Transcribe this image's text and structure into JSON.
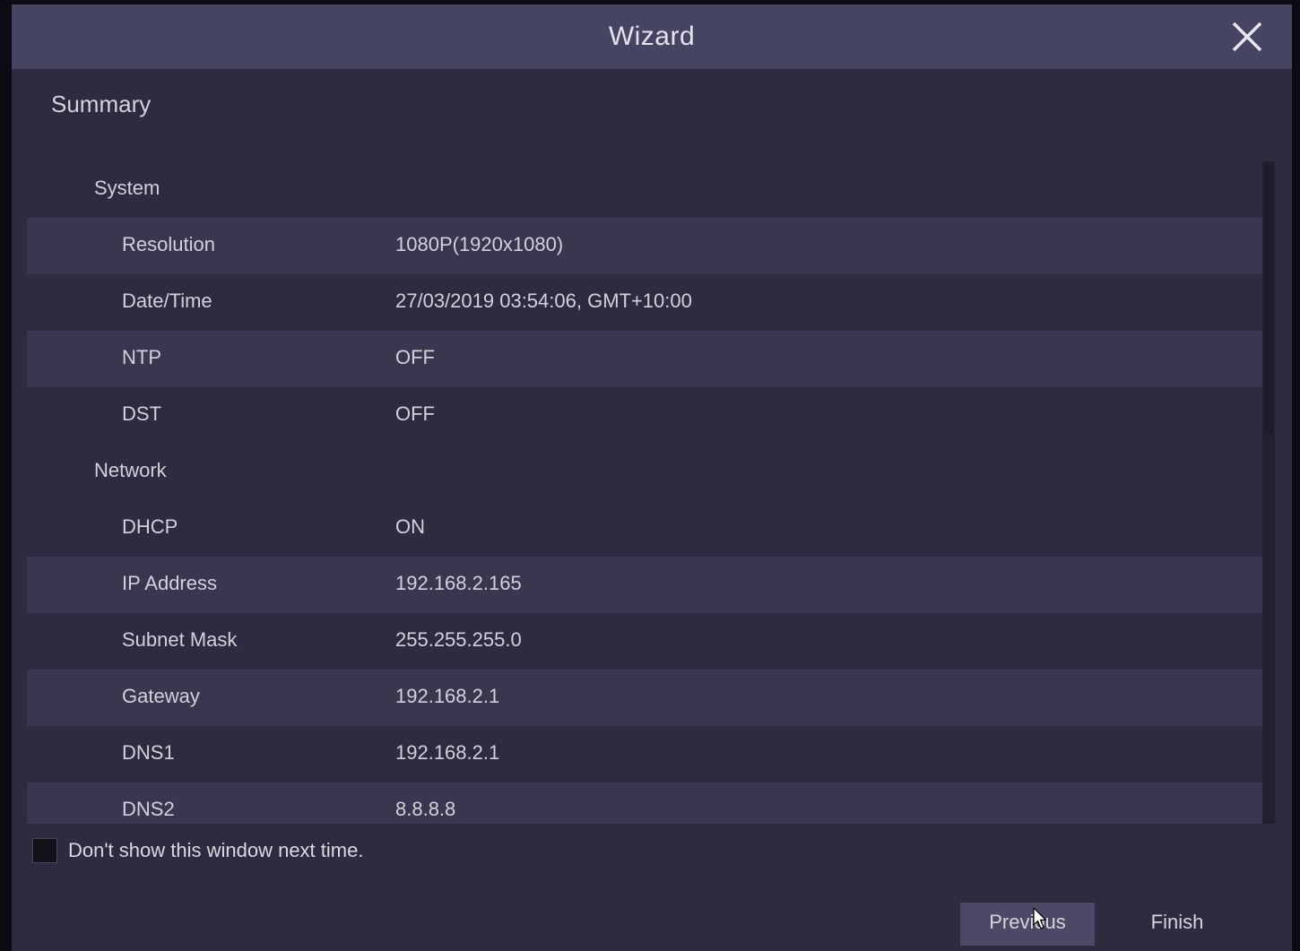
{
  "window": {
    "title": "Wizard"
  },
  "section_title": "Summary",
  "groups": {
    "system": "System",
    "network": "Network"
  },
  "rows": {
    "resolution": {
      "label": "Resolution",
      "value": "1080P(1920x1080)"
    },
    "datetime": {
      "label": "Date/Time",
      "value": "27/03/2019 03:54:06, GMT+10:00"
    },
    "ntp": {
      "label": "NTP",
      "value": "OFF"
    },
    "dst": {
      "label": "DST",
      "value": "OFF"
    },
    "dhcp": {
      "label": "DHCP",
      "value": "ON"
    },
    "ip": {
      "label": "IP Address",
      "value": "192.168.2.165"
    },
    "subnet": {
      "label": "Subnet Mask",
      "value": "255.255.255.0"
    },
    "gateway": {
      "label": "Gateway",
      "value": "192.168.2.1"
    },
    "dns1": {
      "label": "DNS1",
      "value": "192.168.2.1"
    },
    "dns2": {
      "label": "DNS2",
      "value": "8.8.8.8"
    }
  },
  "dont_show": {
    "label": "Don't show this window next time.",
    "checked": false
  },
  "buttons": {
    "previous": "Previous",
    "finish": "Finish"
  },
  "icons": {
    "close": "close-icon",
    "cursor": "mouse-pointer-icon"
  },
  "colors": {
    "titlebar": "#464463",
    "body": "#2e2a40",
    "row_alt": "#3a3650",
    "text": "#d2d1db"
  }
}
